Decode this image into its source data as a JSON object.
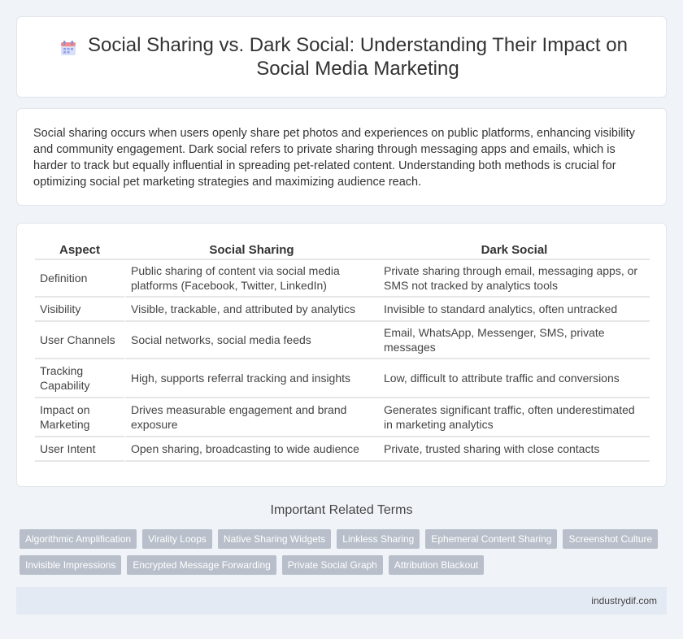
{
  "header": {
    "icon": "calendar-icon",
    "title": "Social Sharing vs. Dark Social: Understanding Their Impact on Social Media Marketing"
  },
  "intro": {
    "text": "Social sharing occurs when users openly share pet photos and experiences on public platforms, enhancing visibility and community engagement. Dark social refers to private sharing through messaging apps and emails, which is harder to track but equally influential in spreading pet-related content. Understanding both methods is crucial for optimizing social pet marketing strategies and maximizing audience reach."
  },
  "table": {
    "headers": [
      "Aspect",
      "Social Sharing",
      "Dark Social"
    ],
    "rows": [
      [
        "Definition",
        "Public sharing of content via social media platforms (Facebook, Twitter, LinkedIn)",
        "Private sharing through email, messaging apps, or SMS not tracked by analytics tools"
      ],
      [
        "Visibility",
        "Visible, trackable, and attributed by analytics",
        "Invisible to standard analytics, often untracked"
      ],
      [
        "User Channels",
        "Social networks, social media feeds",
        "Email, WhatsApp, Messenger, SMS, private messages"
      ],
      [
        "Tracking Capability",
        "High, supports referral tracking and insights",
        "Low, difficult to attribute traffic and conversions"
      ],
      [
        "Impact on Marketing",
        "Drives measurable engagement and brand exposure",
        "Generates significant traffic, often underestimated in marketing analytics"
      ],
      [
        "User Intent",
        "Open sharing, broadcasting to wide audience",
        "Private, trusted sharing with close contacts"
      ]
    ]
  },
  "related": {
    "title": "Important Related Terms",
    "terms": [
      "Algorithmic Amplification",
      "Virality Loops",
      "Native Sharing Widgets",
      "Linkless Sharing",
      "Ephemeral Content Sharing",
      "Screenshot Culture",
      "Invisible Impressions",
      "Encrypted Message Forwarding",
      "Private Social Graph",
      "Attribution Blackout"
    ]
  },
  "footer": {
    "site": "industrydif.com"
  },
  "colors": {
    "background": "#f0f3f8",
    "tag": "#b8bfca",
    "footer": "#e4eaf4"
  }
}
